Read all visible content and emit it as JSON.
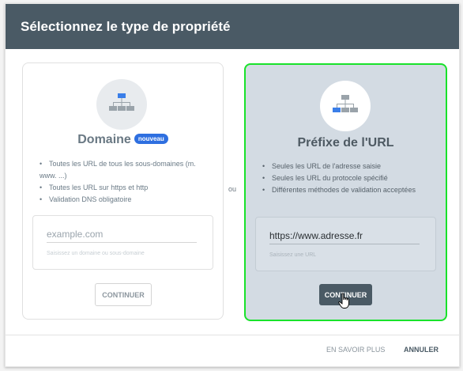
{
  "dialog": {
    "title": "Sélectionnez le type de propriété"
  },
  "domain_card": {
    "icon": "sitemap-icon",
    "title": "Domaine",
    "badge": "nouveau",
    "features": [
      "Toutes les URL de tous les sous-domaines (m. www. ...)",
      "Toutes les URL sur https et http",
      "Validation DNS obligatoire"
    ],
    "input_value": "",
    "input_placeholder": "example.com",
    "input_hint": "Saisissez un domaine ou sous-domaine",
    "button_label": "CONTINUER"
  },
  "separator": "ou",
  "url_prefix_card": {
    "icon": "sitemap-icon",
    "title": "Préfixe de l'URL",
    "features": [
      "Seules les URL de l'adresse saisie",
      "Seules les URL du protocole spécifié",
      "Différentes méthodes de validation acceptées"
    ],
    "input_value": "https://www.adresse.fr",
    "input_hint": "Saisissez une URL",
    "button_label": "CONTINUER",
    "selected": true
  },
  "footer": {
    "learn_more": "EN SAVOIR PLUS",
    "cancel": "ANNULER"
  },
  "colors": {
    "header_bg": "#4a5a65",
    "selected_border": "#19e22b",
    "selected_bg": "#d3dbe3",
    "badge_bg": "#2e6fe0",
    "icon_blue": "#3a7ee8"
  }
}
